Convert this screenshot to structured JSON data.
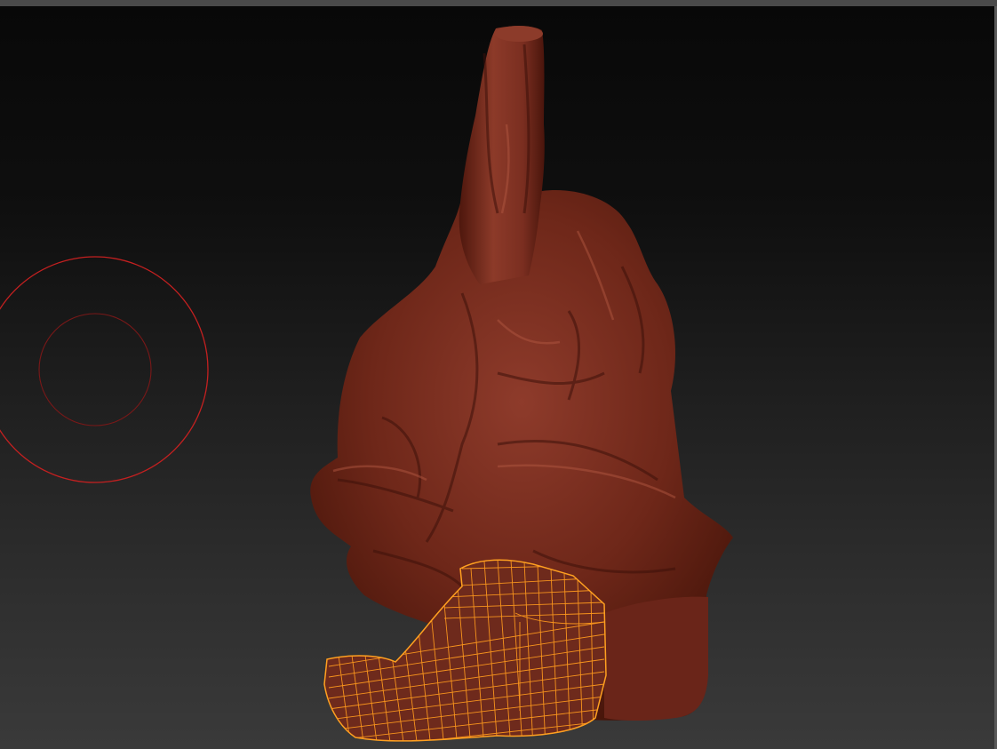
{
  "viewport": {
    "background_top": "#080808",
    "background_bottom": "#3a3a3a"
  },
  "model": {
    "material_color": "#7a2f22",
    "shadow_color": "#3f120c",
    "highlight_color": "#a24a38"
  },
  "mesh_selection": {
    "wire_color": "#ff9a1e"
  },
  "brush_cursor": {
    "color": "#c42020"
  }
}
